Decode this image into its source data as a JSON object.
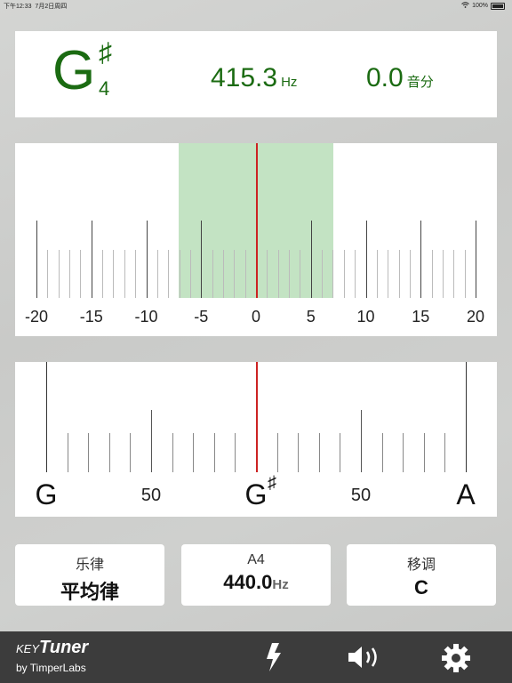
{
  "status_bar": {
    "time": "下午12:33",
    "date": "7月2日周四",
    "battery": "100%"
  },
  "tuner": {
    "note": "G",
    "accidental": "♯",
    "octave": "4",
    "frequency": "415.3",
    "frequency_unit": "Hz",
    "cents": "0.0",
    "cents_unit": "音分",
    "needle_cents": 0
  },
  "cents_scale": {
    "labels": [
      "-20",
      "-15",
      "-10",
      "-5",
      "0",
      "5",
      "10",
      "15",
      "20"
    ],
    "in_tune_range": 7
  },
  "note_scale": {
    "left_note": "G",
    "center_note": "G",
    "center_accidental": "♯",
    "right_note": "A",
    "left_cents": "50",
    "right_cents": "50"
  },
  "settings": {
    "temperament": {
      "title": "乐律",
      "value": "平均律"
    },
    "reference": {
      "title": "A4",
      "value": "440.0",
      "unit": "Hz"
    },
    "transpose": {
      "title": "移调",
      "value": "C"
    }
  },
  "toolbar": {
    "brand_key": "KEY",
    "brand_tuner": "Tuner",
    "brand_by": "by TimperLabs"
  },
  "colors": {
    "accent": "#1b6b12",
    "needle": "#cc2222",
    "zone": "#c3e3c3",
    "toolbar": "#3c3c3c"
  },
  "icons": [
    "lightning-icon",
    "speaker-icon",
    "gear-icon"
  ]
}
